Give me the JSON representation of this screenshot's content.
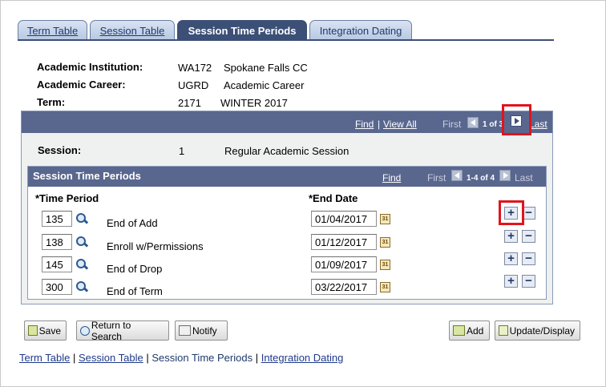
{
  "tabs": [
    {
      "label": "Term Table",
      "active": false
    },
    {
      "label": "Session Table",
      "active": false
    },
    {
      "label": "Session Time Periods",
      "active": true
    },
    {
      "label": "Integration Dating",
      "active": false
    }
  ],
  "info": {
    "institution_label": "Academic Institution:",
    "institution_code": "WA172",
    "institution_name": "Spokane Falls CC",
    "career_label": "Academic Career:",
    "career_code": "UGRD",
    "career_name": "Academic Career",
    "term_label": "Term:",
    "term_code": "2171",
    "term_name": "WINTER 2017"
  },
  "outer_nav": {
    "find": "Find",
    "view_all": "View All",
    "separator": "|",
    "first": "First",
    "count": "1 of 3",
    "last": "Last"
  },
  "session": {
    "label": "Session:",
    "code": "1",
    "name": "Regular Academic Session"
  },
  "periods_box": {
    "title": "Session Time Periods",
    "find": "Find",
    "first": "First",
    "count": "1-4 of 4",
    "last": "Last",
    "col_time_period": "*Time Period",
    "col_end_date": "*End Date"
  },
  "rows": [
    {
      "code": "135",
      "desc": "End of Add",
      "date": "01/04/2017"
    },
    {
      "code": "138",
      "desc": "Enroll w/Permissions",
      "date": "01/12/2017"
    },
    {
      "code": "145",
      "desc": "End of Drop",
      "date": "01/09/2017"
    },
    {
      "code": "300",
      "desc": "End of Term",
      "date": "03/22/2017"
    }
  ],
  "row_buttons": {
    "add": "+",
    "remove": "−"
  },
  "calendar_glyph": "31",
  "toolbar": {
    "save": "Save",
    "return_to_search": "Return to Search",
    "notify": "Notify",
    "add": "Add",
    "update_display": "Update/Display"
  },
  "footer_links": {
    "term_table": "Term Table",
    "session_table": "Session Table",
    "session_time_periods": "Session Time Periods",
    "integration_dating": "Integration Dating",
    "separator": "|"
  },
  "colors": {
    "header_bar": "#59678f",
    "active_tab": "#3c4f76",
    "highlight": "#e0141c"
  }
}
